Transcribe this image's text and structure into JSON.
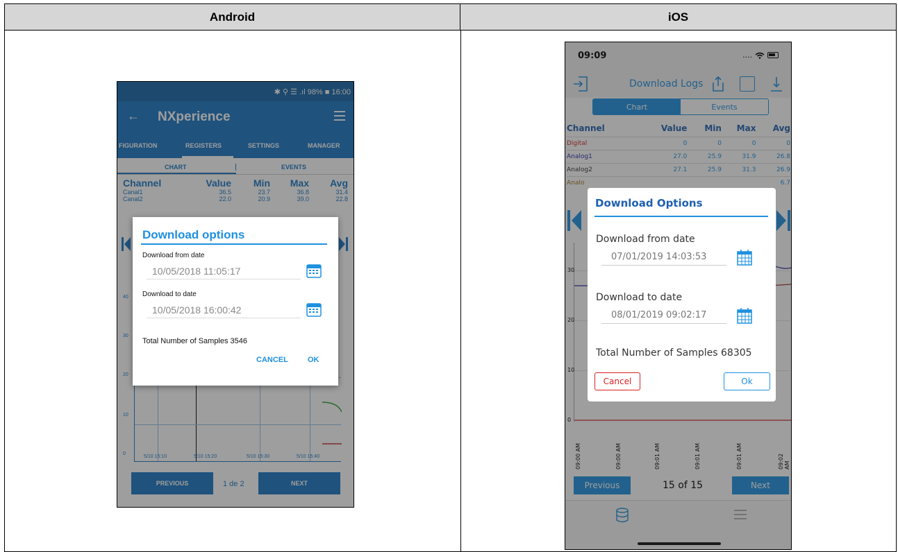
{
  "table": {
    "left_header": "Android",
    "right_header": "iOS"
  },
  "android": {
    "status": "✱ ⚲ ☰ .ıl 98% ■ 16:00",
    "back_icon": "back-arrow-icon",
    "title": "NXperience",
    "tabs": [
      "FIGURATION",
      "REGISTERS",
      "SETTINGS",
      "MANAGER"
    ],
    "subtabs": [
      "CHART",
      "EVENTS"
    ],
    "columns": [
      "Channel",
      "Value",
      "Min",
      "Max",
      "Avg"
    ],
    "rows": [
      [
        "Canal1",
        "36.5",
        "23.7",
        "36.8",
        "31.4"
      ],
      [
        "Canal2",
        "22.0",
        "20.9",
        "39.0",
        "22.8"
      ]
    ],
    "y_ticks": [
      "40",
      "30",
      "20",
      "10",
      "0"
    ],
    "x_ticks": [
      "5/10 15:10",
      "5/10 15:20",
      "5/10 15:30",
      "5/10 15:40"
    ],
    "pager": {
      "previous": "PREVIOUS",
      "page": "1 de 2",
      "next": "NEXT"
    },
    "dialog": {
      "title": "Download options",
      "from_label": "Download from date",
      "from_value": "10/05/2018 11:05:17",
      "to_label": "Download to date",
      "to_value": "10/05/2018 16:00:42",
      "total": "Total Number of Samples  3546",
      "cancel": "CANCEL",
      "ok": "OK"
    },
    "colors": {
      "primary": "#1976c4",
      "accent": "#1e90e0"
    }
  },
  "ios": {
    "time": "09:09",
    "signal": "....",
    "nav_title": "Download Logs",
    "segments": [
      "Chart",
      "Events"
    ],
    "columns": [
      "Channel",
      "Value",
      "Min",
      "Max",
      "Avg"
    ],
    "rows": [
      {
        "name": "Digital",
        "value": "0",
        "min": "0",
        "max": "0",
        "avg": "0",
        "color": "#d62020"
      },
      {
        "name": "Analog1",
        "value": "27.0",
        "min": "25.9",
        "max": "31.9",
        "avg": "26.8",
        "color": "#2a2ab0"
      },
      {
        "name": "Analog2",
        "value": "27.1",
        "min": "25.9",
        "max": "31.3",
        "avg": "26.9",
        "color": "#333333"
      },
      {
        "name": "Analo",
        "value": "",
        "min": "",
        "max": "",
        "avg": "6.7",
        "color": "#a07020"
      }
    ],
    "y_ticks": [
      "30",
      "20",
      "10",
      "0"
    ],
    "x_ticks": [
      "09:00 AM",
      "09:00 AM",
      "09:01 AM",
      "09:01 AM",
      "09:01 AM",
      "09:02 AM"
    ],
    "pager": {
      "previous": "Previous",
      "page": "15 of 15",
      "next": "Next"
    },
    "dialog": {
      "title": "Download Options",
      "from_label": "Download from date",
      "from_value": "07/01/2019 14:03:53",
      "to_label": "Download to date",
      "to_value": "08/01/2019 09:02:17",
      "total": "Total Number of Samples 68305",
      "cancel": "Cancel",
      "ok": "Ok"
    }
  }
}
